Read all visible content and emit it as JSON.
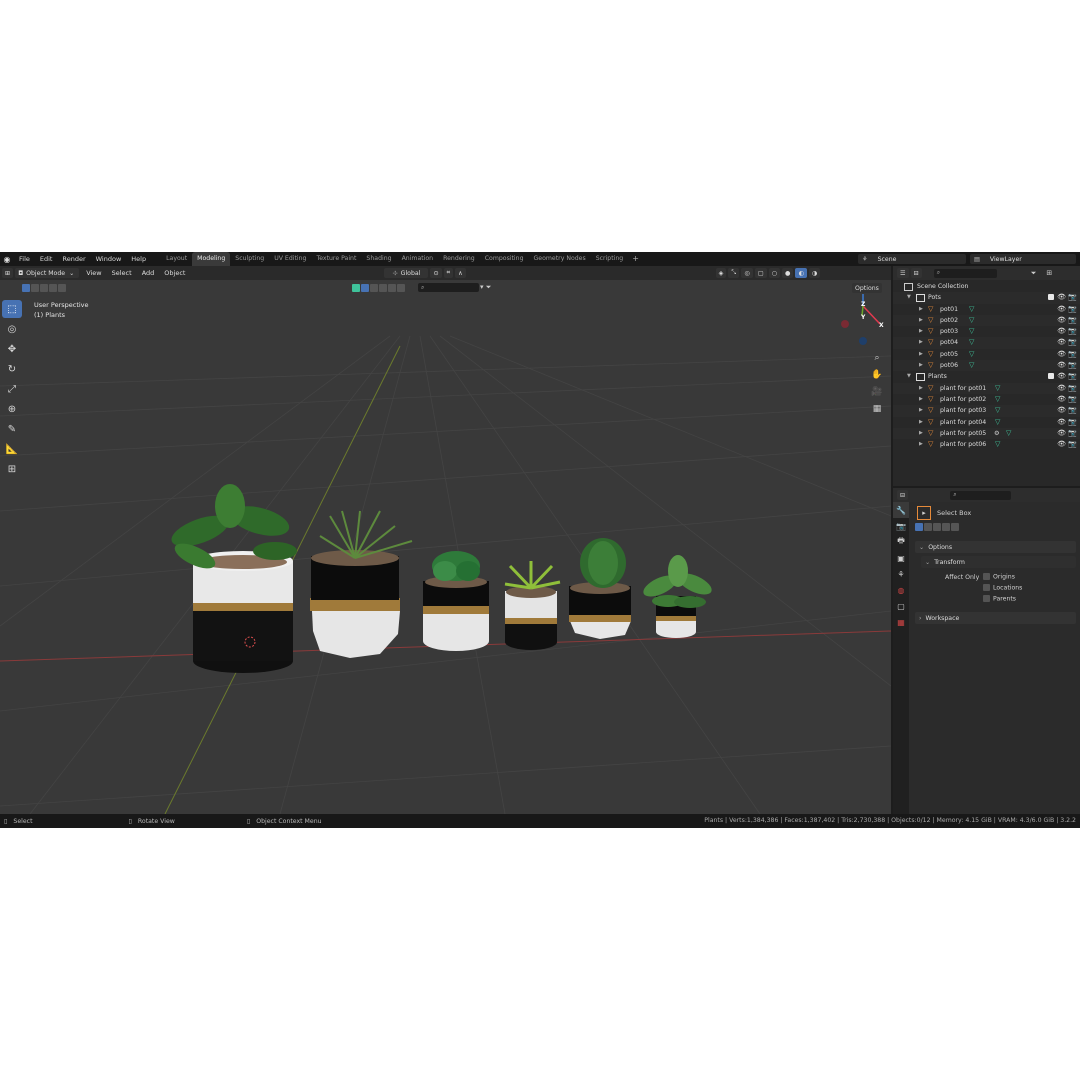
{
  "topbar": {
    "menus": [
      "File",
      "Edit",
      "Render",
      "Window",
      "Help"
    ],
    "workspaces": [
      "Layout",
      "Modeling",
      "Sculpting",
      "UV Editing",
      "Texture Paint",
      "Shading",
      "Animation",
      "Rendering",
      "Compositing",
      "Geometry Nodes",
      "Scripting"
    ],
    "active_workspace": "Modeling",
    "add_tab": "+",
    "scene": "Scene",
    "view_layer": "ViewLayer"
  },
  "viewport_header": {
    "mode": "Object Mode",
    "menus": [
      "View",
      "Select",
      "Add",
      "Object"
    ],
    "transform_orientation": "Global",
    "options": "Options"
  },
  "viewport": {
    "perspective": "User Perspective",
    "collection": "(1) Plants",
    "gizmo": {
      "z": "Z",
      "y": "Y",
      "x": "X"
    }
  },
  "outliner": {
    "root": "Scene Collection",
    "collections": [
      {
        "name": "Pots",
        "objects": [
          "pot01",
          "pot02",
          "pot03",
          "pot04",
          "pot05",
          "pot06"
        ]
      },
      {
        "name": "Plants",
        "objects": [
          "plant for pot01",
          "plant for pot02",
          "plant for pot03",
          "plant for pot04",
          "plant for pot05",
          "plant for pot06"
        ]
      }
    ]
  },
  "properties": {
    "tool_name": "Select Box",
    "options_label": "Options",
    "transform_label": "Transform",
    "affect_only_label": "Affect Only",
    "affect_only": [
      "Origins",
      "Locations",
      "Parents"
    ],
    "workspace_label": "Workspace"
  },
  "status_bar": {
    "select": "Select",
    "rotate": "Rotate View",
    "context_menu": "Object Context Menu",
    "stats": "Plants | Verts:1,384,386 | Faces:1,387,402 | Tris:2,730,388 | Objects:0/12 | Memory: 4.15 GiB | VRAM: 4.3/6.0 GiB | 3.2.2"
  },
  "colors": {
    "accent": "#4772b3",
    "object_icon": "#e58a3a",
    "mesh_icon": "#3fc39b",
    "axis_x": "#e2394f",
    "axis_y": "#6ca52a",
    "axis_z": "#3c7cd6"
  }
}
